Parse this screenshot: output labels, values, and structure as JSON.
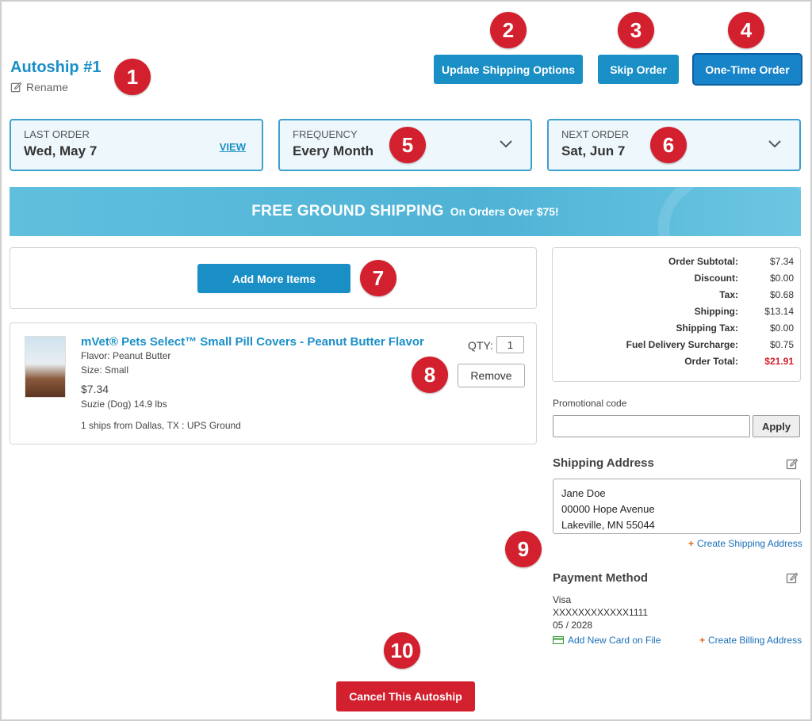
{
  "header": {
    "title": "Autoship #1",
    "rename_label": "Rename",
    "buttons": {
      "update_shipping": "Update Shipping Options",
      "skip_order": "Skip Order",
      "one_time_order": "One-Time Order"
    }
  },
  "cards": {
    "last_order": {
      "label": "LAST ORDER",
      "value": "Wed, May 7",
      "link": "VIEW"
    },
    "frequency": {
      "label": "FREQUENCY",
      "value": "Every Month"
    },
    "next_order": {
      "label": "NEXT ORDER",
      "value": "Sat, Jun 7"
    }
  },
  "banner": {
    "headline": "FREE GROUND SHIPPING",
    "subline": "On Orders Over $75!"
  },
  "add_items_label": "Add More Items",
  "product": {
    "name": "mVet® Pets Select™ Small Pill Covers - Peanut Butter Flavor",
    "flavor": "Flavor: Peanut Butter",
    "size": "Size: Small",
    "price": "$7.34",
    "pet": "Suzie (Dog) 14.9 lbs",
    "ships": "1 ships from Dallas, TX : UPS Ground",
    "qty_label": "QTY:",
    "qty": "1",
    "remove_label": "Remove"
  },
  "summary": [
    {
      "label": "Order Subtotal:",
      "value": "$7.34"
    },
    {
      "label": "Discount:",
      "value": "$0.00"
    },
    {
      "label": "Tax:",
      "value": "$0.68"
    },
    {
      "label": "Shipping:",
      "value": "$13.14"
    },
    {
      "label": "Shipping Tax:",
      "value": "$0.00"
    },
    {
      "label": "Fuel Delivery Surcharge:",
      "value": "$0.75"
    },
    {
      "label": "Order Total:",
      "value": "$21.91"
    }
  ],
  "promo": {
    "label": "Promotional code",
    "value": "",
    "apply": "Apply"
  },
  "shipping_address": {
    "title": "Shipping Address",
    "lines": [
      "Jane Doe",
      "00000 Hope Avenue",
      "Lakeville, MN 55044"
    ],
    "create_link": "Create Shipping Address"
  },
  "payment": {
    "title": "Payment Method",
    "card_type": "Visa",
    "card_number": "XXXXXXXXXXXX1111",
    "expiry": "05 / 2028",
    "add_card": "Add New Card on File",
    "create_billing": "Create Billing Address"
  },
  "cancel_label": "Cancel This Autoship",
  "markers": [
    "1",
    "2",
    "3",
    "4",
    "5",
    "6",
    "7",
    "8",
    "9",
    "10"
  ],
  "colors": {
    "brand_blue": "#1a8fc6",
    "marker_red": "#d3202e",
    "banner": "#5bbbdb"
  }
}
